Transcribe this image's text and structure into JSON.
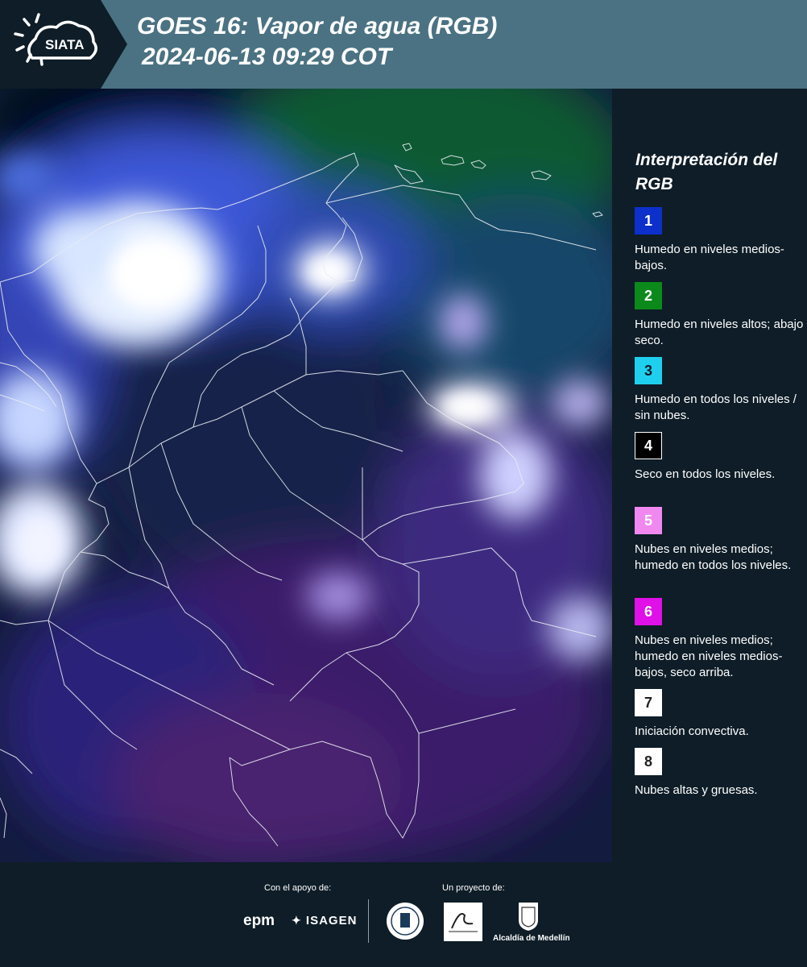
{
  "header": {
    "logo_text": "SIATA",
    "title_line1": "GOES 16: Vapor de agua (RGB)",
    "title_line2": "2024-06-13 09:29 COT",
    "background_color": "#4a7282"
  },
  "map": {
    "product": "GOES 16 water vapor RGB composite",
    "region": "Colombia"
  },
  "legend": {
    "title": "Interpretación del RGB",
    "items": [
      {
        "num": "1",
        "color": "#0d2fcc",
        "text": "Humedo en niveles medios-bajos."
      },
      {
        "num": "2",
        "color": "#0b8a1b",
        "text": "Humedo en niveles altos; abajo seco."
      },
      {
        "num": "3",
        "color": "#1fd0ee",
        "text": "Humedo en todos los niveles / sin nubes."
      },
      {
        "num": "4",
        "color": "#000000",
        "text": "Seco en todos los niveles."
      },
      {
        "num": "5",
        "color": "#f088f0",
        "text": "Nubes en niveles medios; humedo en todos los niveles."
      },
      {
        "num": "6",
        "color": "#e010e8",
        "text": "Nubes en niveles medios; humedo en niveles medios-bajos, seco arriba."
      },
      {
        "num": "7",
        "color": "#ffffff",
        "text": "Iniciación convectiva."
      },
      {
        "num": "8",
        "color": "#ffffff",
        "text": "Nubes altas y gruesas."
      }
    ]
  },
  "footer": {
    "support_label": "Con el apoyo de:",
    "project_label": "Un proyecto de:",
    "epm": "epm",
    "isagen": "ISAGEN",
    "alcaldia": "Alcaldía de Medellín"
  }
}
